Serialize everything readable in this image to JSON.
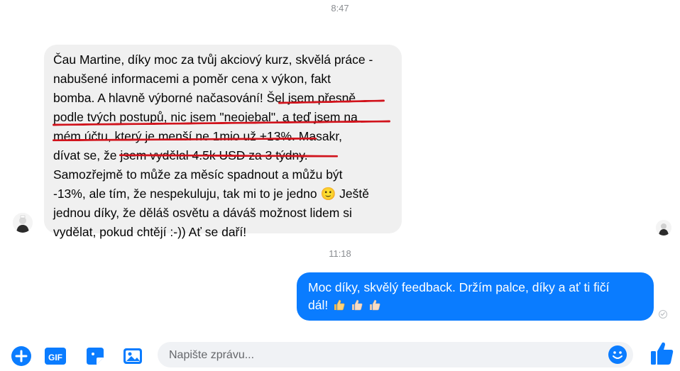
{
  "conversation": {
    "timestamps": [
      "8:47",
      "11:18"
    ],
    "incoming_message": {
      "text": "Čau Martine, díky moc za tvůj akciový kurz, skvělá práce -\nnabušené informacemi a poměr cena x výkon, fakt\nbomba. A hlavně výborné načasování! Šel jsem přesně\npodle tvých postupů, nic jsem \"neojebal\", a teď jsem na\nmém účtu, který je menší ne 1mio už +13%. Masakr,\ndívat se, že jsem vydělal 4.5k USD za 3 týdny.\nSamozřejmě to může za měsíc spadnout a můžu být\n-13%, ale tím, že nespekuluju, tak mi to je jedno 🙂 Ještě\njednou díky, že děláš osvětu a dáváš možnost lidem si\nvydělat, pokud chtějí :-)) Ať se daří!",
      "highlight_color": "#d1131c"
    },
    "outgoing_message": {
      "text": "Moc díky, skvělý feedback. Držím palce, díky a ať ti fičí\ndál!",
      "emoji": [
        "thumbs-up-icon",
        "thumbs-up-icon",
        "thumbs-up-icon"
      ]
    }
  },
  "composer": {
    "placeholder": "Napište zprávu...",
    "icons": [
      "plus-icon",
      "gif-icon",
      "sticker-icon",
      "image-icon",
      "emoji-icon",
      "like-icon"
    ]
  },
  "colors": {
    "accent": "#0a7cff",
    "incoming_bubble": "#f0f0f0",
    "timestamp": "#8a8d91"
  }
}
